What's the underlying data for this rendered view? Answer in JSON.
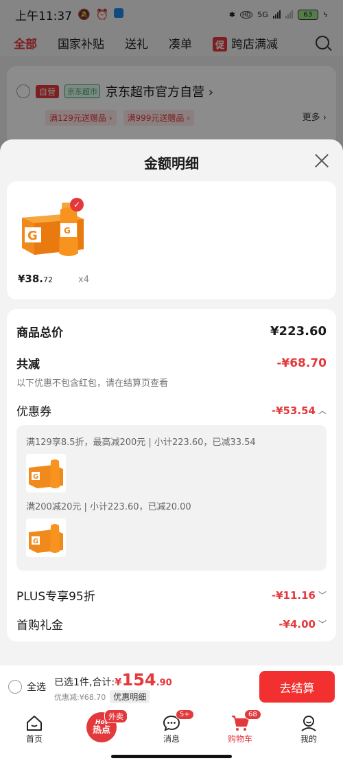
{
  "status_bar": {
    "time": "上午11:37",
    "network": "5G",
    "battery": "63"
  },
  "top_nav": {
    "tabs": [
      "全部",
      "国家补贴",
      "送礼",
      "凑单"
    ],
    "promo_tag": "促",
    "promo_label": "跨店满减"
  },
  "shop": {
    "badge_self": "自营",
    "badge_store": "京东超市",
    "name": "京东超市官方自营 ›",
    "coupons": [
      "满129元送赠品 ›",
      "满999元送赠品 ›"
    ],
    "more": "更多 ›"
  },
  "sheet": {
    "title": "金额明细",
    "product": {
      "price_int": "¥38.",
      "price_dec": "72",
      "qty": "x4"
    },
    "total_label": "商品总价",
    "total_value": "¥223.60",
    "reduce_label": "共减",
    "reduce_value": "-¥68.70",
    "reduce_note": "以下优惠不包含红包，请在结算页查看",
    "coupon_label": "优惠券",
    "coupon_value": "-¥53.54",
    "coupon_lines": [
      "满129享8.5折，最高减200元 | 小计223.60，已减33.54",
      "满200减20元 | 小计223.60，已减20.00"
    ],
    "plus_label": "PLUS专享95折",
    "plus_value": "-¥11.16",
    "first_label": "首购礼金",
    "first_value": "-¥4.00"
  },
  "checkout": {
    "select_all": "全选",
    "summary_prefix": "已选1件,合计:",
    "currency": "¥",
    "amount_int": "154",
    "amount_dec": ".90",
    "discount": "优惠减:¥68.70",
    "detail_btn": "优惠明细",
    "go_btn": "去结算"
  },
  "tabbar": {
    "items": [
      "首页",
      "",
      "消息",
      "购物车",
      "我的"
    ],
    "hot_text": "热点",
    "hot_tag": "外卖",
    "msg_badge": "5+",
    "cart_badge": "68"
  },
  "colors": {
    "accent": "#e4393c"
  }
}
